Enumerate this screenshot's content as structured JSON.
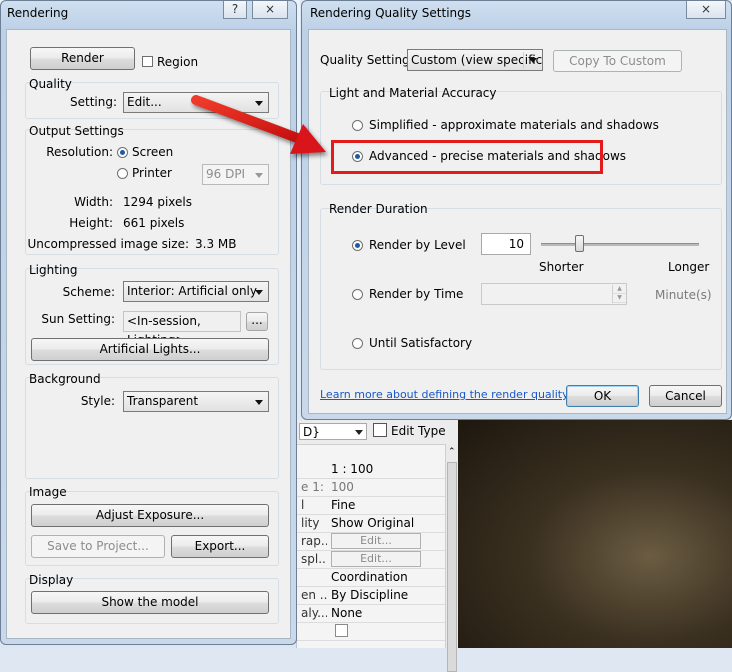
{
  "rendering": {
    "title": "Rendering",
    "help": "?",
    "close": "×",
    "render_button": "Render",
    "region_label": "Region",
    "quality": {
      "title": "Quality",
      "setting_label": "Setting:",
      "setting_value": "Edit..."
    },
    "output": {
      "title": "Output Settings",
      "resolution_label": "Resolution:",
      "screen_label": "Screen",
      "printer_label": "Printer",
      "dpi_value": "96 DPI",
      "width_label": "Width:",
      "width_value": "1294 pixels",
      "height_label": "Height:",
      "height_value": "661 pixels",
      "size_label": "Uncompressed image size:",
      "size_value": "3.3 MB"
    },
    "lighting": {
      "title": "Lighting",
      "scheme_label": "Scheme:",
      "scheme_value": "Interior: Artificial only",
      "sun_label": "Sun Setting:",
      "sun_value": "<In-session, Lighting>",
      "sun_browse": "...",
      "artificial_button": "Artificial Lights..."
    },
    "background": {
      "title": "Background",
      "style_label": "Style:",
      "style_value": "Transparent"
    },
    "image": {
      "title": "Image",
      "adjust_button": "Adjust Exposure...",
      "save_button": "Save to Project...",
      "export_button": "Export..."
    },
    "display": {
      "title": "Display",
      "show_button": "Show the model"
    }
  },
  "quality_dialog": {
    "title": "Rendering Quality Settings",
    "close": "×",
    "setting_label": "Quality Setting:",
    "setting_value": "Custom (view specific)",
    "copy_button": "Copy To Custom",
    "accuracy": {
      "title": "Light and Material Accuracy",
      "simplified": "Simplified - approximate materials and shadows",
      "advanced": "Advanced - precise materials and shadows"
    },
    "duration": {
      "title": "Render Duration",
      "by_level": "Render by Level",
      "level_value": "10",
      "shorter": "Shorter",
      "longer": "Longer",
      "by_time": "Render by Time",
      "time_unit": "Minute(s)",
      "until": "Until Satisfactory"
    },
    "learn_link": "Learn more about defining the render quality",
    "ok": "OK",
    "cancel": "Cancel"
  },
  "properties": {
    "type_combo": "D}",
    "edit_type": "Edit Type",
    "rows": [
      {
        "key": "",
        "value": "1 : 100"
      },
      {
        "key": "e  1:",
        "value": "100"
      },
      {
        "key": "l",
        "value": "Fine"
      },
      {
        "key": "lity",
        "value": "Show Original"
      },
      {
        "key": "rap...",
        "value": "Edit..."
      },
      {
        "key": "spl...",
        "value": "Edit..."
      },
      {
        "key": "",
        "value": "Coordination"
      },
      {
        "key": "en ...",
        "value": "By Discipline"
      },
      {
        "key": "aly...",
        "value": "None"
      },
      {
        "key": "",
        "value": ""
      }
    ]
  },
  "colors": {
    "accent_highlight": "#e31b1b",
    "link": "#1a57c4",
    "window_frame": "#c9d9ea"
  }
}
